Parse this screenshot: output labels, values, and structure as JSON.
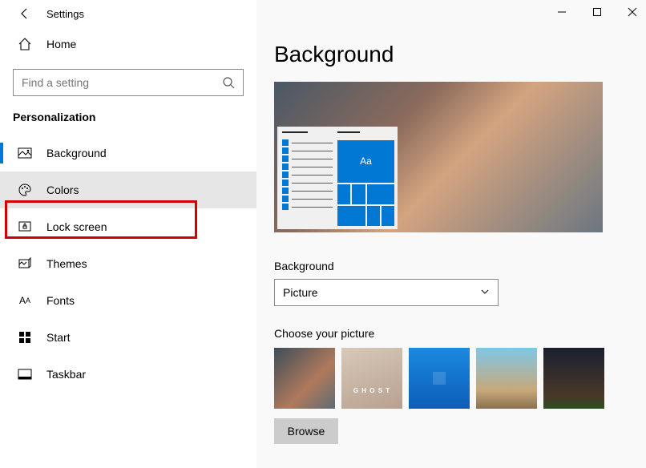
{
  "window": {
    "title": "Settings"
  },
  "home": {
    "label": "Home"
  },
  "search": {
    "placeholder": "Find a setting"
  },
  "category": "Personalization",
  "nav": {
    "items": [
      {
        "label": "Background"
      },
      {
        "label": "Colors"
      },
      {
        "label": "Lock screen"
      },
      {
        "label": "Themes"
      },
      {
        "label": "Fonts"
      },
      {
        "label": "Start"
      },
      {
        "label": "Taskbar"
      }
    ]
  },
  "page": {
    "title": "Background",
    "preview_sample": "Aa",
    "background_label": "Background",
    "background_dropdown": "Picture",
    "choose_picture_label": "Choose your picture",
    "browse_button": "Browse"
  }
}
